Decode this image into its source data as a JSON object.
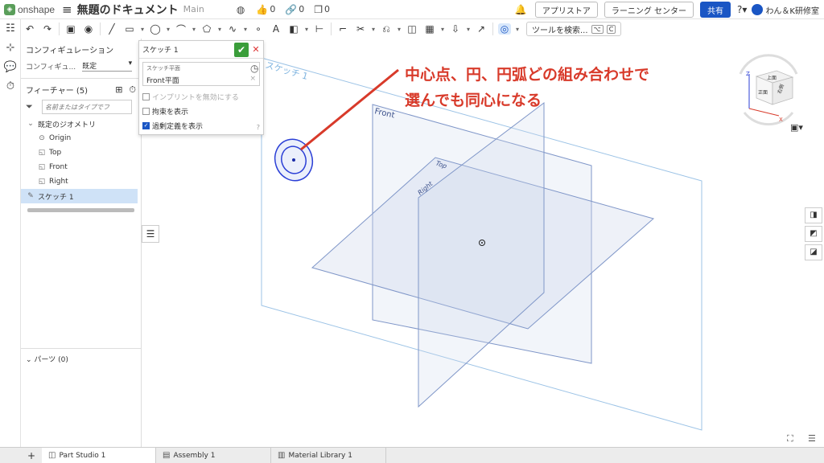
{
  "header": {
    "app_name": "onshape",
    "logo_glyph": "◈",
    "document_title": "無題のドキュメント",
    "workspace": "Main",
    "likes": "0",
    "links": "0",
    "copies": "0",
    "app_store": "アプリストア",
    "learning_center": "ラーニング センター",
    "share": "共有",
    "user": "わん＆K研修室",
    "accent_color": "#1a56c4"
  },
  "toolbar": {
    "tool_search": "ツールを検索...",
    "shortcut_1": "⌥",
    "shortcut_2": "C"
  },
  "config": {
    "title": "コンフィギュレーション",
    "label": "コンフィギュ...",
    "value": "既定"
  },
  "features": {
    "title": "フィーチャー (5)",
    "filter_placeholder": "名前またはタイプでフ",
    "default_geometry": "既定のジオメトリ",
    "items": [
      "Origin",
      "Top",
      "Front",
      "Right"
    ],
    "sketch": "スケッチ 1",
    "parts": "パーツ (0)"
  },
  "sketch_dialog": {
    "title": "スケッチ 1",
    "plane_label": "スケッチ平面",
    "plane_value": "Front平面",
    "clear": "×",
    "options": [
      {
        "label": "インプリントを無効にする",
        "checked": false,
        "disabled": true
      },
      {
        "label": "拘束を表示",
        "checked": false,
        "disabled": false
      },
      {
        "label": "過剰定義を表示",
        "checked": true,
        "disabled": false
      }
    ]
  },
  "viewport": {
    "sketch_label": "スケッチ 1",
    "front_label": "Front",
    "top_label": "Top",
    "right_label": "Right",
    "annotation_line1": "中心点、円、円弧どの組み合わせで",
    "annotation_line2": "選んでも同心になる",
    "annotation_color": "#d83a2a",
    "cube_top": "上面",
    "cube_front": "正面",
    "cube_right": "右側",
    "axis_x": "X",
    "axis_z": "Z"
  },
  "tabs": {
    "items": [
      "Part Studio 1",
      "Assembly 1",
      "Material Library 1"
    ]
  }
}
